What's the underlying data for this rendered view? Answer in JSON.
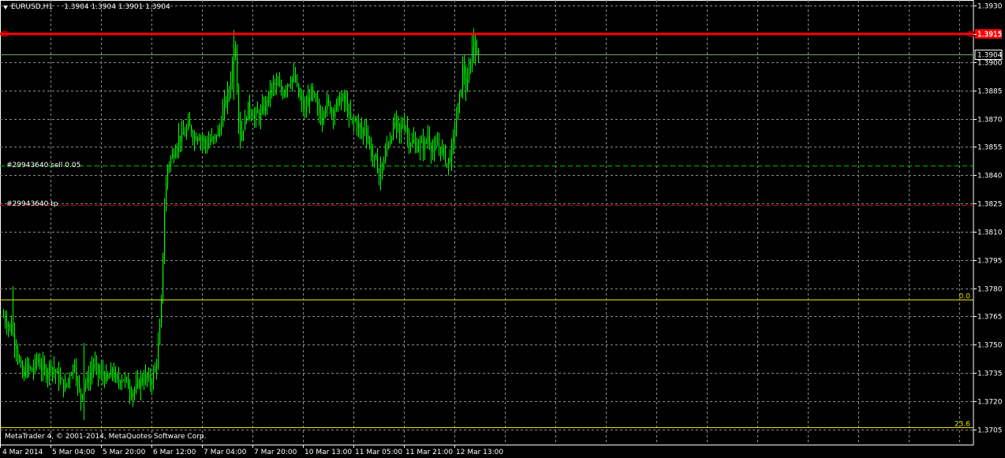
{
  "header": {
    "symbol": "EURUSD,H1",
    "ohlc": "1.3904 1.3904 1.3901 1.3904"
  },
  "copyright": "MetaTrader 4, © 2001-2014, MetaQuotes Software Corp.",
  "colors": {
    "background": "#000000",
    "grid": "#8c8c8c",
    "candle": "#00ff00",
    "axis_text": "#ffffff",
    "alert_line": "#ff0000",
    "fibo": "#e6e600",
    "order_line": "#00c000",
    "tp_line": "#cc0000",
    "bid_line": "#7fa07f"
  },
  "icons": [
    "chevron-down-icon"
  ],
  "chart_data": {
    "type": "candlestick",
    "symbol": "EURUSD",
    "timeframe": "H1",
    "ylim": [
      1.3697,
      1.3933
    ],
    "grid": true,
    "y_ticks": [
      "1.3930",
      "1.3915",
      "1.3900",
      "1.3885",
      "1.3870",
      "1.3855",
      "1.3840",
      "1.3825",
      "1.3810",
      "1.3795",
      "1.3780",
      "1.3765",
      "1.3750",
      "1.3735",
      "1.3720",
      "1.3705"
    ],
    "x_tick_labels": [
      "4 Mar 2014",
      "5 Mar 04:00",
      "5 Mar 20:00",
      "6 Mar 12:00",
      "7 Mar 04:00",
      "7 Mar 20:00",
      "10 Mar 13:00",
      "11 Mar 05:00",
      "11 Mar 21:00",
      "12 Mar 13:00"
    ],
    "price_path": [
      [
        0,
        1.377
      ],
      [
        4,
        1.3765
      ],
      [
        8,
        1.3762
      ],
      [
        12,
        1.376
      ],
      [
        16,
        1.3755
      ],
      [
        20,
        1.375
      ],
      [
        24,
        1.374
      ],
      [
        28,
        1.3733
      ],
      [
        34,
        1.3738
      ],
      [
        40,
        1.3736
      ],
      [
        46,
        1.3742
      ],
      [
        52,
        1.3738
      ],
      [
        58,
        1.3735
      ],
      [
        64,
        1.374
      ],
      [
        70,
        1.3735
      ],
      [
        76,
        1.3731
      ],
      [
        82,
        1.3727
      ],
      [
        88,
        1.3735
      ],
      [
        94,
        1.374
      ],
      [
        98,
        1.3728
      ],
      [
        102,
        1.3722
      ],
      [
        106,
        1.373
      ],
      [
        110,
        1.373
      ],
      [
        114,
        1.3735
      ],
      [
        118,
        1.374
      ],
      [
        124,
        1.3735
      ],
      [
        130,
        1.3734
      ],
      [
        136,
        1.3731
      ],
      [
        142,
        1.3736
      ],
      [
        148,
        1.373
      ],
      [
        154,
        1.3733
      ],
      [
        160,
        1.373
      ],
      [
        166,
        1.3725
      ],
      [
        172,
        1.3727
      ],
      [
        178,
        1.3731
      ],
      [
        184,
        1.3733
      ],
      [
        190,
        1.373
      ],
      [
        195,
        1.3735
      ],
      [
        198,
        1.3742
      ],
      [
        201,
        1.3752
      ],
      [
        204,
        1.3772
      ],
      [
        206,
        1.38
      ],
      [
        208,
        1.3822
      ],
      [
        210,
        1.3835
      ],
      [
        212,
        1.3845
      ],
      [
        215,
        1.3848
      ],
      [
        218,
        1.385
      ],
      [
        222,
        1.3855
      ],
      [
        226,
        1.386
      ],
      [
        230,
        1.386
      ],
      [
        234,
        1.3862
      ],
      [
        238,
        1.3866
      ],
      [
        242,
        1.3864
      ],
      [
        246,
        1.386
      ],
      [
        250,
        1.3862
      ],
      [
        254,
        1.386
      ],
      [
        258,
        1.3858
      ],
      [
        262,
        1.3856
      ],
      [
        266,
        1.3859
      ],
      [
        270,
        1.3858
      ],
      [
        274,
        1.3862
      ],
      [
        278,
        1.3864
      ],
      [
        282,
        1.3874
      ],
      [
        286,
        1.388
      ],
      [
        290,
        1.3885
      ],
      [
        293,
        1.3895
      ],
      [
        296,
        1.391
      ],
      [
        298,
        1.3905
      ],
      [
        300,
        1.389
      ],
      [
        302,
        1.387
      ],
      [
        304,
        1.386
      ],
      [
        306,
        1.3864
      ],
      [
        310,
        1.3868
      ],
      [
        314,
        1.3876
      ],
      [
        318,
        1.3874
      ],
      [
        322,
        1.3871
      ],
      [
        326,
        1.3872
      ],
      [
        330,
        1.3872
      ],
      [
        334,
        1.3876
      ],
      [
        338,
        1.388
      ],
      [
        342,
        1.3884
      ],
      [
        346,
        1.3888
      ],
      [
        350,
        1.3887
      ],
      [
        354,
        1.3886
      ],
      [
        358,
        1.3884
      ],
      [
        362,
        1.3888
      ],
      [
        366,
        1.389
      ],
      [
        370,
        1.3892
      ],
      [
        374,
        1.389
      ],
      [
        378,
        1.3882
      ],
      [
        382,
        1.3878
      ],
      [
        386,
        1.3874
      ],
      [
        390,
        1.388
      ],
      [
        394,
        1.3884
      ],
      [
        398,
        1.388
      ],
      [
        402,
        1.3875
      ],
      [
        406,
        1.387
      ],
      [
        410,
        1.3876
      ],
      [
        414,
        1.3878
      ],
      [
        418,
        1.3876
      ],
      [
        422,
        1.3874
      ],
      [
        426,
        1.3877
      ],
      [
        430,
        1.388
      ],
      [
        434,
        1.388
      ],
      [
        438,
        1.3878
      ],
      [
        442,
        1.3871
      ],
      [
        446,
        1.3868
      ],
      [
        450,
        1.3869
      ],
      [
        454,
        1.3866
      ],
      [
        458,
        1.3862
      ],
      [
        462,
        1.3866
      ],
      [
        466,
        1.386
      ],
      [
        470,
        1.3852
      ],
      [
        474,
        1.3848
      ],
      [
        478,
        1.3844
      ],
      [
        482,
        1.384
      ],
      [
        486,
        1.3848
      ],
      [
        490,
        1.3856
      ],
      [
        494,
        1.386
      ],
      [
        498,
        1.3865
      ],
      [
        502,
        1.3868
      ],
      [
        506,
        1.3862
      ],
      [
        510,
        1.3868
      ],
      [
        514,
        1.3866
      ],
      [
        518,
        1.3858
      ],
      [
        522,
        1.3858
      ],
      [
        526,
        1.3855
      ],
      [
        530,
        1.3856
      ],
      [
        534,
        1.3856
      ],
      [
        538,
        1.3856
      ],
      [
        542,
        1.3861
      ],
      [
        546,
        1.3855
      ],
      [
        550,
        1.3852
      ],
      [
        554,
        1.3856
      ],
      [
        558,
        1.3854
      ],
      [
        562,
        1.3852
      ],
      [
        566,
        1.3846
      ],
      [
        570,
        1.385
      ],
      [
        574,
        1.3858
      ],
      [
        576,
        1.3866
      ],
      [
        578,
        1.387
      ],
      [
        580,
        1.3876
      ],
      [
        582,
        1.388
      ],
      [
        584,
        1.3888
      ],
      [
        586,
        1.3896
      ],
      [
        588,
        1.3894
      ],
      [
        590,
        1.3886
      ],
      [
        592,
        1.3888
      ],
      [
        594,
        1.3896
      ],
      [
        596,
        1.39
      ],
      [
        598,
        1.3908
      ],
      [
        600,
        1.3912
      ],
      [
        602,
        1.3907
      ],
      [
        604,
        1.3904
      ],
      [
        606,
        1.3904
      ]
    ],
    "lines": {
      "alert": {
        "price": 1.3915,
        "label": "1.3915"
      },
      "bid": {
        "price": 1.3904,
        "label": "1.3904"
      },
      "order": {
        "price": 1.3845,
        "label": "#29943640 sell 0.05"
      },
      "take_profit": {
        "price": 1.3824,
        "label": "#29943640 tp"
      },
      "fibo": [
        {
          "price": 1.3774,
          "label": "0.0"
        },
        {
          "price": 1.3706,
          "label": "23.6"
        }
      ]
    }
  }
}
